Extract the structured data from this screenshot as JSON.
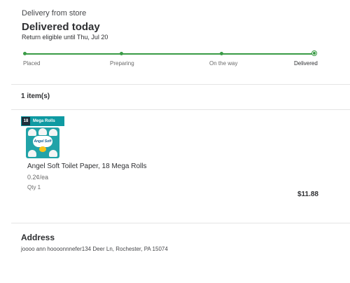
{
  "header": {
    "delivery_from": "Delivery from store",
    "status_title": "Delivered today",
    "return_note": "Return eligible until Thu, Jul 20"
  },
  "tracking": {
    "steps": [
      "Placed",
      "Preparing",
      "On the way",
      "Delivered"
    ],
    "current_step": "Delivered",
    "accent_color": "#3a9b46"
  },
  "items": {
    "count_label": "1 item(s)",
    "list": [
      {
        "badge_count": "18",
        "badge_text": "Mega Rolls",
        "pack_brand": "Angel Soft",
        "name": "Angel Soft Toilet Paper, 18 Mega Rolls",
        "unit_price": "0.2¢/ea",
        "qty": "Qty 1",
        "price": "$11.88"
      }
    ]
  },
  "address": {
    "title": "Address",
    "text": "joooo ann hoooonnnefer134 Deer Ln, Rochester, PA 15074"
  }
}
